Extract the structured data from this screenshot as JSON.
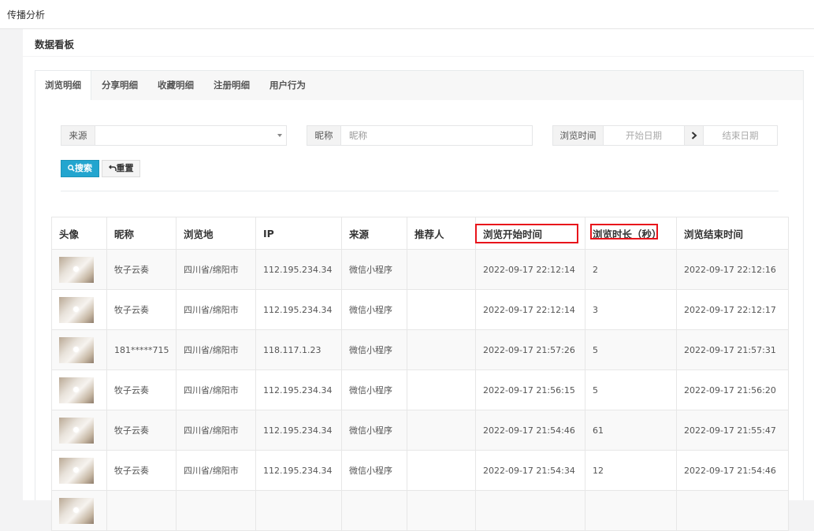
{
  "breadcrumb": "传播分析",
  "panel": {
    "title": "数据看板"
  },
  "tabs": [
    {
      "label": "浏览明细",
      "active": true
    },
    {
      "label": "分享明细",
      "active": false
    },
    {
      "label": "收藏明细",
      "active": false
    },
    {
      "label": "注册明细",
      "active": false
    },
    {
      "label": "用户行为",
      "active": false
    }
  ],
  "filters": {
    "source_label": "来源",
    "source_value": "",
    "nickname_label": "昵称",
    "nickname_placeholder": "昵称",
    "time_label": "浏览时间",
    "start_placeholder": "开始日期",
    "end_placeholder": "结束日期",
    "search_label": "搜索",
    "reset_label": "重置"
  },
  "table": {
    "columns": [
      "头像",
      "昵称",
      "浏览地",
      "IP",
      "来源",
      "推荐人",
      "浏览开始时间",
      "浏览时长（秒）",
      "浏览结束时间"
    ],
    "rows": [
      {
        "nickname": "牧子云奏",
        "location": "四川省/绵阳市",
        "ip": "112.195.234.34",
        "source": "微信小程序",
        "referrer": "",
        "start": "2022-09-17 22:12:14",
        "duration": "2",
        "end": "2022-09-17 22:12:16"
      },
      {
        "nickname": "牧子云奏",
        "location": "四川省/绵阳市",
        "ip": "112.195.234.34",
        "source": "微信小程序",
        "referrer": "",
        "start": "2022-09-17 22:12:14",
        "duration": "3",
        "end": "2022-09-17 22:12:17"
      },
      {
        "nickname": "181*****715",
        "location": "四川省/绵阳市",
        "ip": "118.117.1.23",
        "source": "微信小程序",
        "referrer": "",
        "start": "2022-09-17 21:57:26",
        "duration": "5",
        "end": "2022-09-17 21:57:31"
      },
      {
        "nickname": "牧子云奏",
        "location": "四川省/绵阳市",
        "ip": "112.195.234.34",
        "source": "微信小程序",
        "referrer": "",
        "start": "2022-09-17 21:56:15",
        "duration": "5",
        "end": "2022-09-17 21:56:20"
      },
      {
        "nickname": "牧子云奏",
        "location": "四川省/绵阳市",
        "ip": "112.195.234.34",
        "source": "微信小程序",
        "referrer": "",
        "start": "2022-09-17 21:54:46",
        "duration": "61",
        "end": "2022-09-17 21:55:47"
      },
      {
        "nickname": "牧子云奏",
        "location": "四川省/绵阳市",
        "ip": "112.195.234.34",
        "source": "微信小程序",
        "referrer": "",
        "start": "2022-09-17 21:54:34",
        "duration": "12",
        "end": "2022-09-17 21:54:46"
      }
    ]
  },
  "colors": {
    "primary": "#23a5cf",
    "highlight": "#e8141b"
  },
  "icons": {
    "search": "search-icon",
    "reset": "undo-icon",
    "range": "chevron-right-icon",
    "dropdown": "caret-down-icon"
  }
}
